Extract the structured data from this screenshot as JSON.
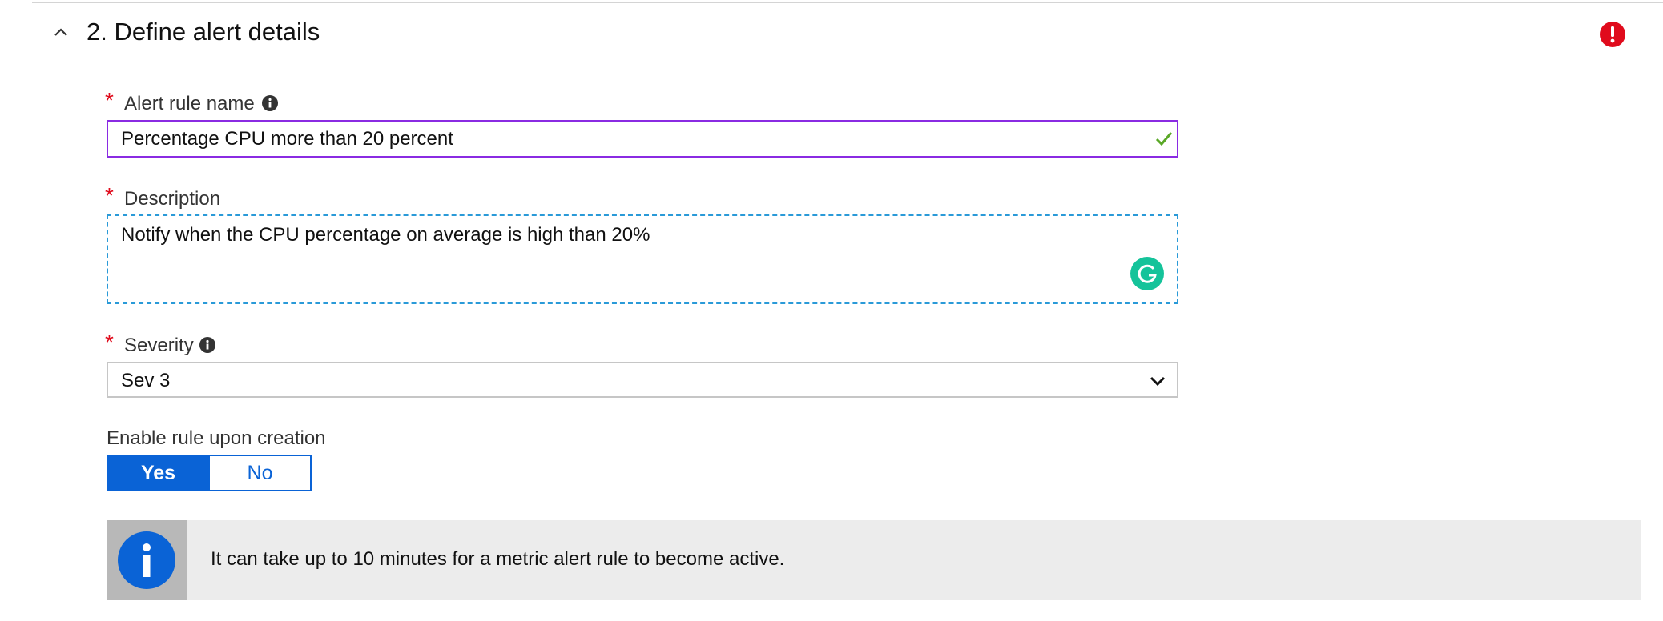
{
  "section": {
    "title": "2. Define alert details",
    "collapse_icon": "chevron-up-icon",
    "status_icon": "error-icon",
    "status_color": "#e00b1c"
  },
  "alert_rule_name": {
    "required_mark": "*",
    "label": "Alert rule name",
    "value": "Percentage CPU more than 20 percent",
    "info_icon": "info-icon",
    "valid_icon": "checkmark-icon"
  },
  "description": {
    "required_mark": "*",
    "label": "Description",
    "value": "Notify when the CPU percentage on average is high than 20%",
    "assist_icon": "grammarly-icon"
  },
  "severity": {
    "required_mark": "*",
    "label": "Severity",
    "selected": "Sev 3",
    "info_icon": "info-icon",
    "dropdown_icon": "chevron-down-icon"
  },
  "enable_rule": {
    "label": "Enable rule upon creation",
    "yes_label": "Yes",
    "no_label": "No",
    "selected": "Yes"
  },
  "info_banner": {
    "icon": "info-icon",
    "text": "It can take up to 10 minutes for a metric alert rule to become active."
  },
  "colors": {
    "accent": "#0a63d6",
    "required": "#e00b1c",
    "name_border": "#8a2be2",
    "desc_border": "#2a9ad8",
    "valid": "#5aa827",
    "grammarly": "#15c39a"
  }
}
